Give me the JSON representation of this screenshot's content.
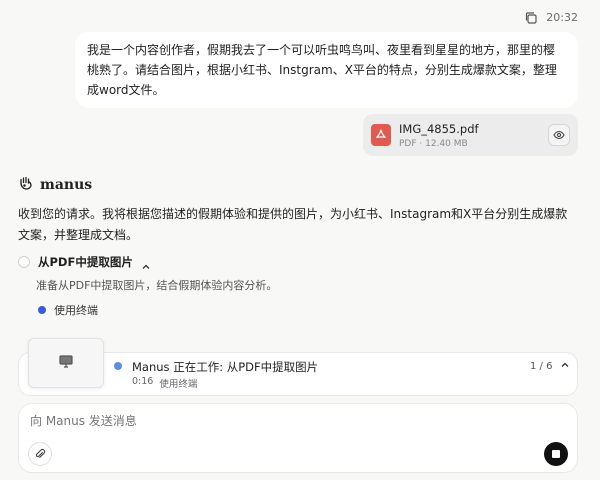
{
  "meta": {
    "time": "20:32"
  },
  "user_message": {
    "text": "我是一个内容创作者，假期我去了一个可以听虫鸣鸟叫、夜里看到星星的地方，那里的樱桃熟了。请结合图片，根据小红书、Instgram、X平台的特点，分别生成爆款文案，整理成word文件。"
  },
  "attachment": {
    "name": "IMG_4855.pdf",
    "meta": "PDF · 12.40 MB",
    "icon": "pdf-icon"
  },
  "assistant": {
    "brand": "manus",
    "reply": "收到您的请求。我将根据您描述的假期体验和提供的图片，为小红书、Instagram和X平台分别生成爆款文案，并整理成文档。",
    "step_title": "从PDF中提取图片",
    "step_desc": "准备从PDF中提取图片，结合假期体验内容分析。",
    "tool_label": "使用终端"
  },
  "working": {
    "title": "Manus 正在工作: 从PDF中提取图片",
    "elapsed": "0:16",
    "tool": "使用终端",
    "page": "1 / 6"
  },
  "composer": {
    "placeholder": "向 Manus 发送消息"
  },
  "colors": {
    "background": "#f8f8f7",
    "pdf_red": "#e05a4f",
    "tool_dot": "#3a5bd9",
    "work_dot": "#5a8fe0",
    "stop_button": "#111111"
  }
}
